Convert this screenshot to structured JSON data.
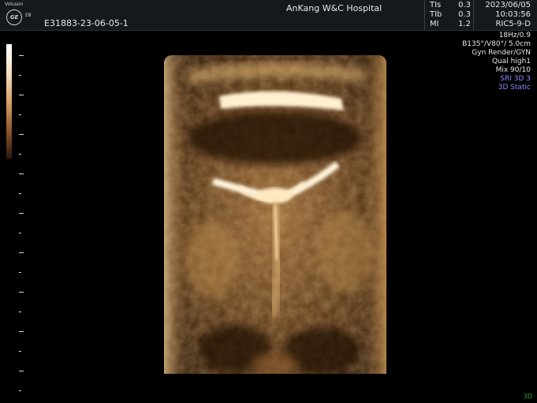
{
  "logo": {
    "brand_text": "Voluson",
    "mark": "GE",
    "suffix": "E8"
  },
  "header": {
    "patient_id": "E31883-23-06-05-1",
    "hospital": "AnKang W&C Hospital",
    "date": "2023/06/05",
    "time": "10:03:56",
    "probe": "RIC5-9-D"
  },
  "params": [
    {
      "label": "TIs",
      "value": "0.3"
    },
    {
      "label": "TIb",
      "value": "0.3"
    },
    {
      "label": "MI",
      "value": "1.2"
    }
  ],
  "settings": {
    "frame_rate": "18Hz/0.9",
    "volume_angles": "B135°/V80°/ 5.0cm",
    "render_mode": "Gyn Render/GYN",
    "quality": "Qual high1",
    "mix": "Mix 90/10",
    "sri": "SRI 3D 3",
    "static": "3D Static"
  },
  "mode_tag": "3D",
  "colors": {
    "accent_blue": "#8b8bff",
    "mode_green": "#2fae2f",
    "render_tint": "#d9a25c"
  }
}
